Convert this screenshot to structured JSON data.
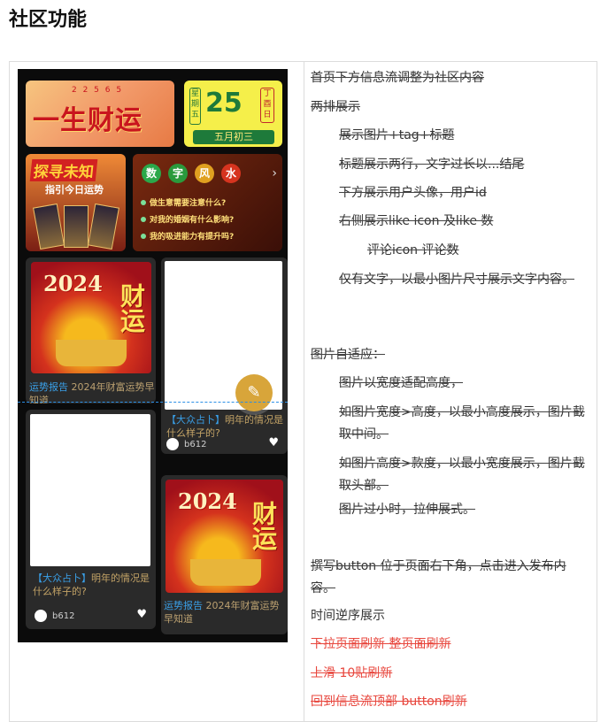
{
  "page_title": "社区功能",
  "mockup": {
    "banner_left": {
      "text": "一生财运",
      "header": "2 2 5 6 5"
    },
    "calendar": {
      "weekday": "星期五",
      "day": "25",
      "ganzhi": "丁酉日",
      "lunar": "五月初三"
    },
    "explore": {
      "title": "探寻未知",
      "subtitle": "指引今日运势"
    },
    "fengshui": {
      "chips": [
        "数",
        "字",
        "风",
        "水"
      ],
      "chip_colors": [
        "#2aa84a",
        "#2a9a3c",
        "#e0a020",
        "#d6341f"
      ],
      "arrow": "›",
      "questions": [
        "做生意需要注意什么?",
        "对我的婚姻有什么影响?",
        "我的吸进能力有提升吗?"
      ]
    },
    "cards": [
      {
        "image_title": "2024",
        "image_char": "财运",
        "tag": "运势报告",
        "title": "2024年财富运势早知道"
      },
      {
        "tag": "【大众占卜】",
        "title": "明年的情况是什么样子的?",
        "user": "b612",
        "like_icon": "heart-icon"
      },
      {
        "tag": "【大众占卜】",
        "title": "明年的情况是什么样子的?",
        "user": "b612",
        "like_icon": "heart-icon"
      },
      {
        "image_title": "2024",
        "image_char": "财运",
        "tag": "运势报告",
        "title": "2024年财富运势早知道"
      }
    ],
    "fab_icon": "pencil-icon"
  },
  "notes": [
    {
      "text": "首页下方信息流调整为社区内容",
      "indent": 0,
      "color": "#333333"
    },
    {
      "text": "两排展示",
      "indent": 0,
      "color": "#333333"
    },
    {
      "text": "展示图片+tag+标题",
      "indent": 1,
      "color": "#333333"
    },
    {
      "text": "标题展示两行，文字过长以...结尾",
      "indent": 1,
      "color": "#333333"
    },
    {
      "text": "下方展示用户头像，用户id",
      "indent": 1,
      "color": "#333333"
    },
    {
      "text": "右侧展示like icon 及like 数",
      "indent": 1,
      "color": "#333333"
    },
    {
      "text": "评论icon 评论数",
      "indent": 2,
      "color": "#333333"
    },
    {
      "text": "仅有文字，以最小图片尺寸展示文字内容。",
      "indent": 1,
      "color": "#333333"
    },
    {
      "text": "图片自适应：",
      "indent": 0,
      "color": "#333333"
    },
    {
      "text": "图片以宽度适配高度，",
      "indent": 1,
      "color": "#333333"
    },
    {
      "text": "如图片宽度>高度，以最小高度展示，图片截取中间。",
      "indent": 1,
      "color": "#333333"
    },
    {
      "text": "如图片高度>款度，以最小宽度展示，图片截取头部。",
      "indent": 1,
      "color": "#333333"
    },
    {
      "text": "图片过小时，拉伸展式。",
      "indent": 1,
      "color": "#333333"
    },
    {
      "text": "撰写button 位于页面右下角，点击进入发布内容。",
      "indent": 0,
      "color": "#333333"
    },
    {
      "text": "时间逆序展示",
      "indent": 0,
      "color": "#333333"
    },
    {
      "text": "下拉页面刷新 整页面刷新",
      "indent": 0,
      "color": "#e8473e"
    },
    {
      "text": "上滑 10贴刷新",
      "indent": 0,
      "color": "#e8473e"
    },
    {
      "text": "回到信息流顶部 button刷新",
      "indent": 0,
      "color": "#e8473e"
    }
  ]
}
